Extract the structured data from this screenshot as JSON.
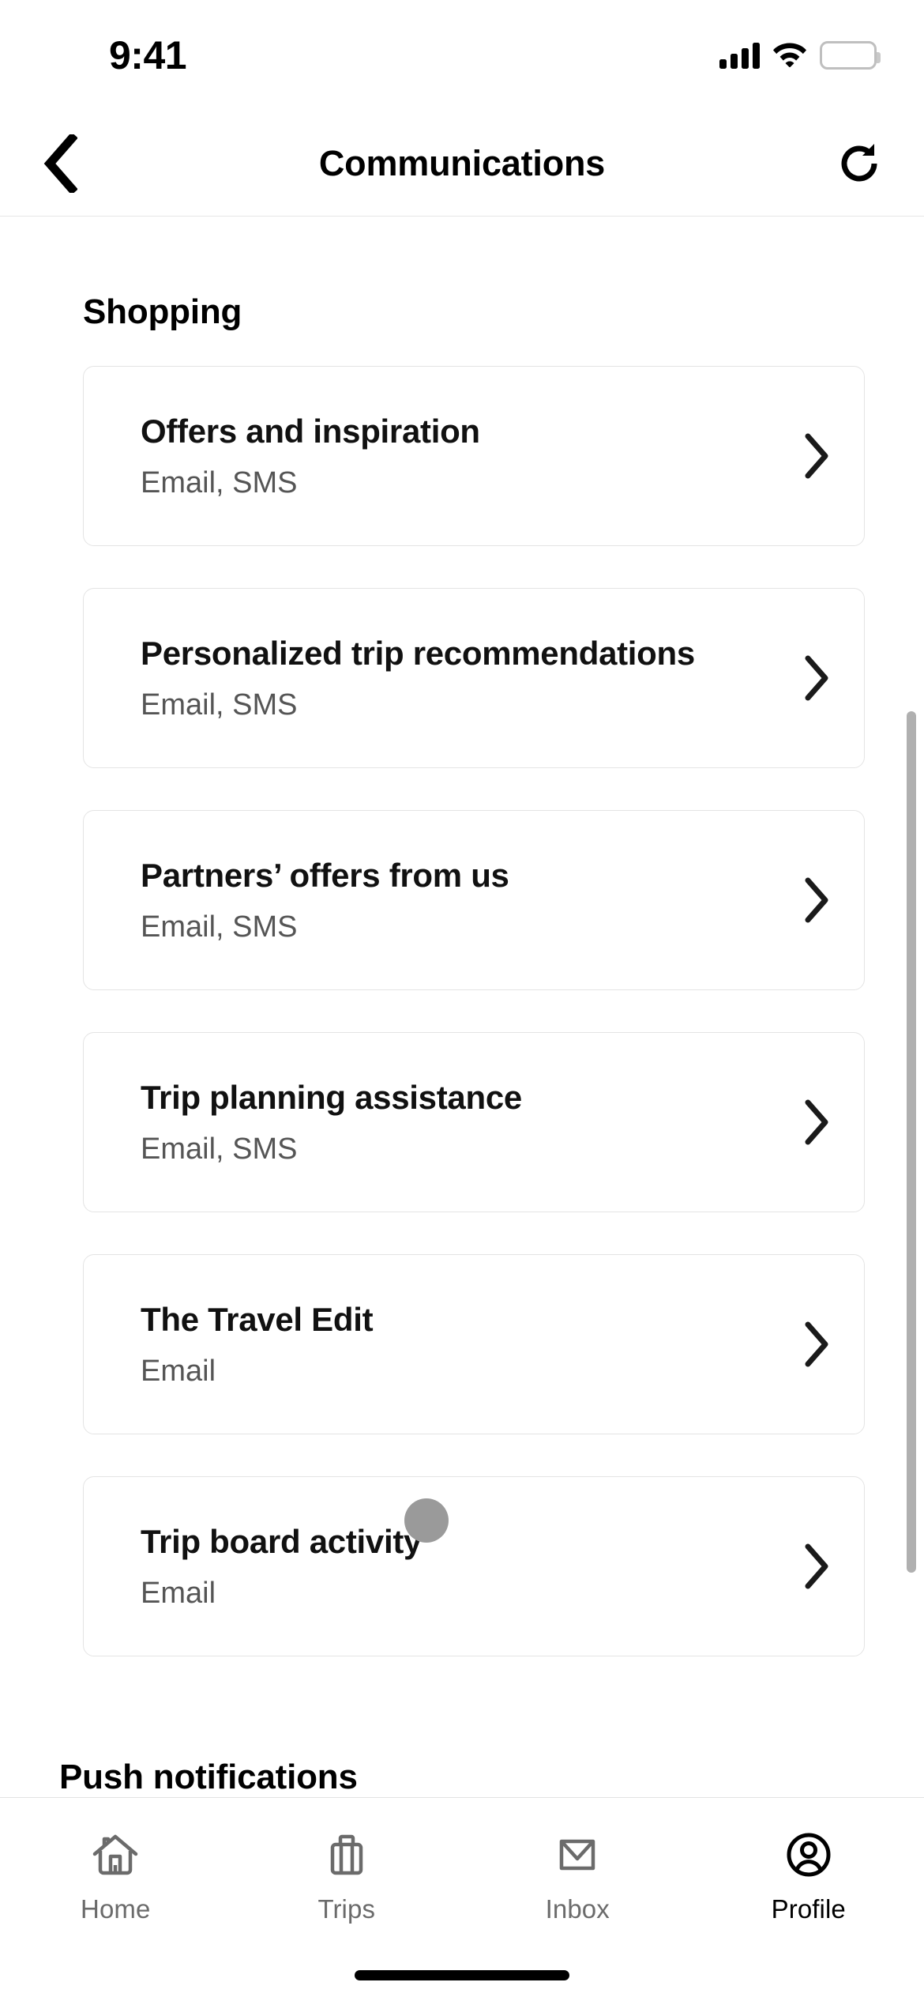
{
  "status_bar": {
    "time": "9:41",
    "signal_icon": "cellular-signal-icon",
    "wifi_icon": "wifi-icon",
    "battery_icon": "battery-full-icon"
  },
  "header": {
    "back_icon": "chevron-left-icon",
    "title": "Communications",
    "refresh_icon": "refresh-icon"
  },
  "sections": [
    {
      "heading": "Shopping",
      "items": [
        {
          "title": "Offers and inspiration",
          "channels": "Email, SMS",
          "chevron": "chevron-right-icon"
        },
        {
          "title": "Personalized trip recommendations",
          "channels": "Email, SMS",
          "chevron": "chevron-right-icon"
        },
        {
          "title": "Partners’ offers from us",
          "channels": "Email, SMS",
          "chevron": "chevron-right-icon"
        },
        {
          "title": "Trip planning assistance",
          "channels": "Email, SMS",
          "chevron": "chevron-right-icon"
        },
        {
          "title": "The Travel Edit",
          "channels": "Email",
          "chevron": "chevron-right-icon"
        },
        {
          "title": "Trip board activity",
          "channels": "Email",
          "chevron": "chevron-right-icon"
        }
      ]
    },
    {
      "heading": "Push notifications",
      "items": []
    }
  ],
  "tab_bar": {
    "tabs": [
      {
        "label": "Home",
        "icon": "home-icon",
        "active": false
      },
      {
        "label": "Trips",
        "icon": "suitcase-icon",
        "active": false
      },
      {
        "label": "Inbox",
        "icon": "envelope-icon",
        "active": false
      },
      {
        "label": "Profile",
        "icon": "user-circle-icon",
        "active": true
      }
    ]
  },
  "colors": {
    "background": "#ffffff",
    "card_border": "#e4e4e4",
    "text_primary": "#111111",
    "text_secondary": "#555555",
    "tab_inactive": "#6b6b6b",
    "tab_active": "#000000",
    "scrollbar": "#b0b0b0",
    "touch_indicator": "#9a9a9a"
  }
}
